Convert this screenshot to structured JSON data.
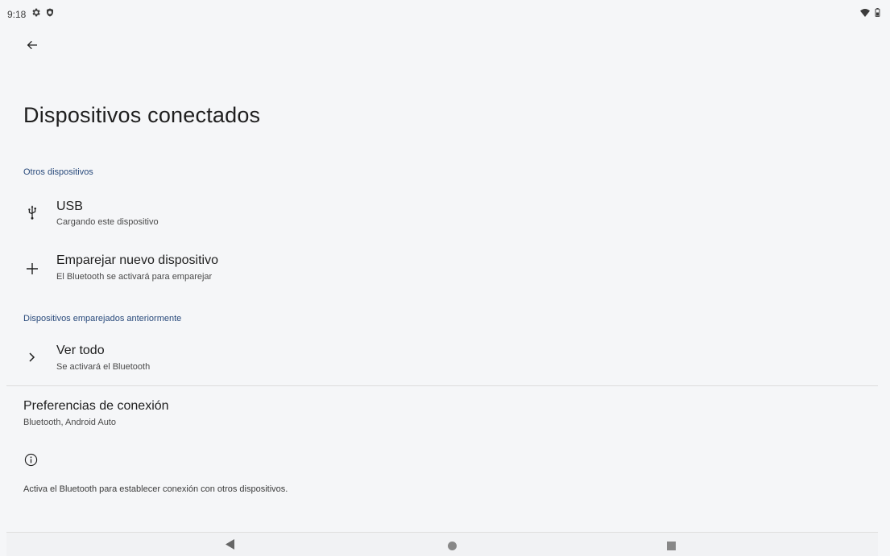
{
  "status_bar": {
    "time": "9:18",
    "left_icons": [
      "gear-icon",
      "shield-icon"
    ],
    "right_icons": [
      "wifi-icon",
      "battery-icon"
    ]
  },
  "toolbar": {
    "back_icon": "arrow-back-icon"
  },
  "page": {
    "title": "Dispositivos conectados"
  },
  "sections": {
    "other_devices": "Otros dispositivos",
    "previously_paired": "Dispositivos emparejados anteriormente"
  },
  "items": {
    "usb": {
      "icon": "usb-icon",
      "title": "USB",
      "summary": "Cargando este dispositivo"
    },
    "pair_new": {
      "icon": "plus-icon",
      "title": "Emparejar nuevo dispositivo",
      "summary": "El Bluetooth se activará para emparejar"
    },
    "see_all": {
      "icon": "chevron-right-icon",
      "title": "Ver todo",
      "summary": "Se activará el Bluetooth"
    },
    "connection_prefs": {
      "title": "Preferencias de conexión",
      "summary": "Bluetooth, Android Auto"
    }
  },
  "footer": {
    "info_icon": "info-icon",
    "text": "Activa el Bluetooth para establecer conexión con otros dispositivos."
  },
  "nav_bar": {
    "back": "nav-back-icon",
    "home": "nav-home-icon",
    "recents": "nav-recents-icon"
  }
}
